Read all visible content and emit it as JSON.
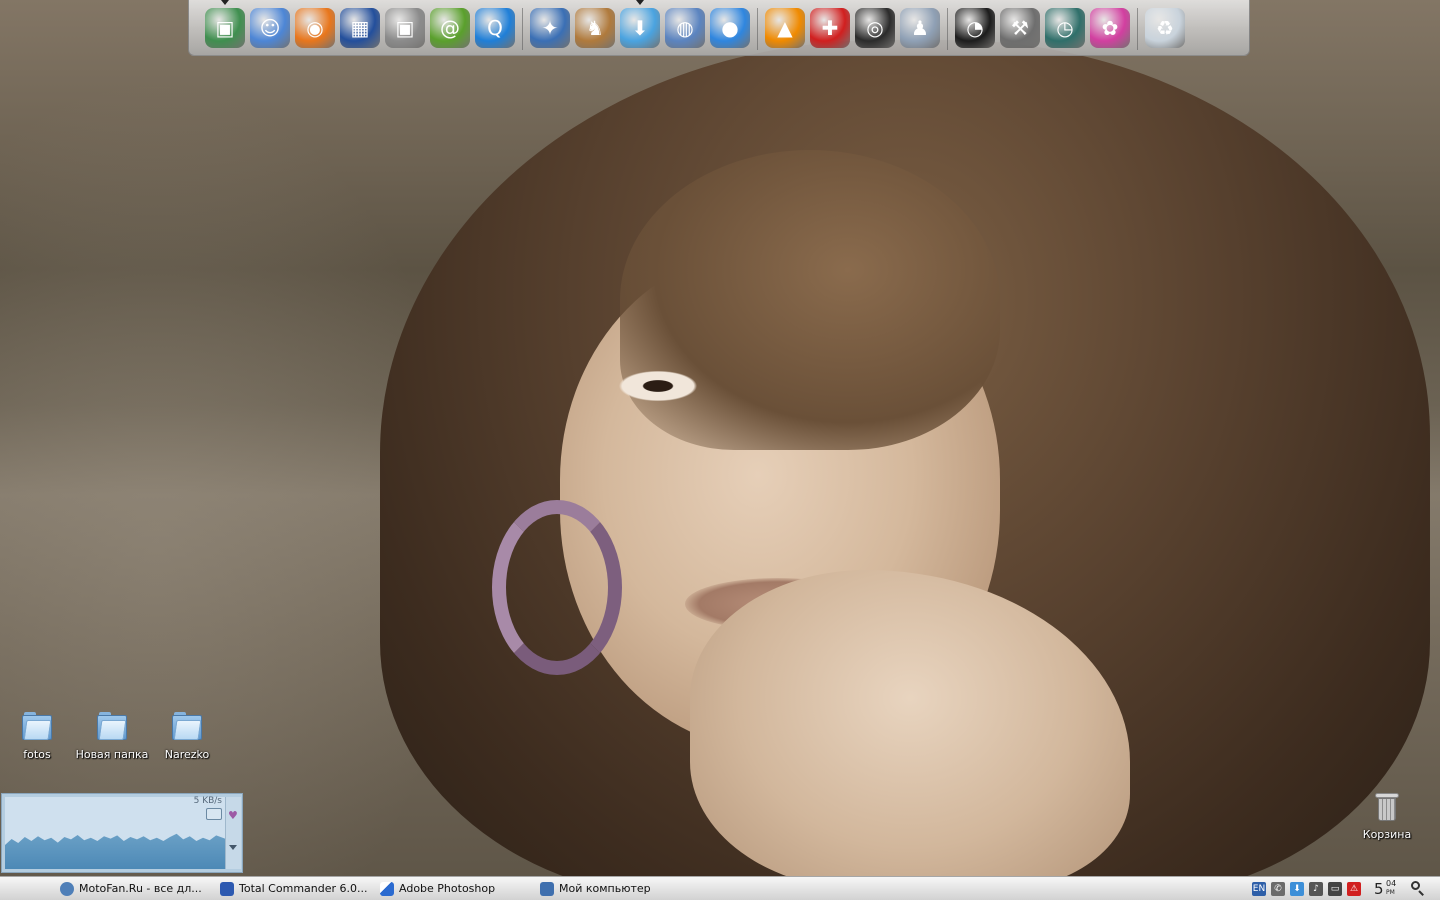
{
  "dock": {
    "groups": [
      [
        {
          "name": "desktop-manager-icon",
          "color": "#3f8f4f",
          "glyph": "▣"
        },
        {
          "name": "finder-icon",
          "color": "#4d86d6",
          "glyph": "☺"
        },
        {
          "name": "blender-icon",
          "color": "#e8761c",
          "glyph": "◉"
        },
        {
          "name": "mosaic-icon",
          "color": "#234f9c",
          "glyph": "▦"
        },
        {
          "name": "camera-icon",
          "color": "#8b8b8b",
          "glyph": "▣"
        },
        {
          "name": "swirl-icon",
          "color": "#5aa02c",
          "glyph": "@"
        },
        {
          "name": "quicktime-icon",
          "color": "#1f7fd8",
          "glyph": "Q"
        }
      ],
      [
        {
          "name": "safari-icon",
          "color": "#3a6fb5",
          "glyph": "✦"
        },
        {
          "name": "emule-icon",
          "color": "#b07a3c",
          "glyph": "♞"
        },
        {
          "name": "download-icon",
          "color": "#4aa3e0",
          "glyph": "⬇"
        },
        {
          "name": "network-globe-icon",
          "color": "#5b84c0",
          "glyph": "◍"
        },
        {
          "name": "video-chat-icon",
          "color": "#2f86df",
          "glyph": "●"
        }
      ],
      [
        {
          "name": "aimp-icon",
          "color": "#f08a00",
          "glyph": "▲"
        },
        {
          "name": "medic-plus-icon",
          "color": "#d11f1f",
          "glyph": "✚"
        },
        {
          "name": "dvd-disc-icon",
          "color": "#2b2b2b",
          "glyph": "◎"
        },
        {
          "name": "robot-icon",
          "color": "#8fa0b5",
          "glyph": "♟"
        }
      ],
      [
        {
          "name": "dashboard-icon",
          "color": "#1c1c1c",
          "glyph": "◔"
        },
        {
          "name": "hammer-icon",
          "color": "#6e6e6e",
          "glyph": "⚒"
        },
        {
          "name": "time-machine-icon",
          "color": "#2f6f6a",
          "glyph": "◷"
        },
        {
          "name": "cat-avatar-icon",
          "color": "#d23fa0",
          "glyph": "✿"
        }
      ],
      [
        {
          "name": "recycle-bin-icon",
          "color": "#c9d3dc",
          "glyph": "♻"
        }
      ]
    ]
  },
  "desktop": {
    "folders": [
      {
        "label": "fotos"
      },
      {
        "label": "Новая папка"
      },
      {
        "label": "Narezko"
      }
    ],
    "trash_label": "Корзина"
  },
  "meter": {
    "rate": "5 KB/s"
  },
  "taskbar": {
    "tasks": [
      {
        "label": "MotoFan.Ru - все дл...",
        "icon": "browser-icon",
        "color": "#4f7fb8"
      },
      {
        "label": "Total Commander 6.0...",
        "icon": "floppy-icon",
        "color": "#2d59b0"
      },
      {
        "label": "Adobe Photoshop",
        "icon": "feather-icon",
        "color": "#2a6ad0"
      },
      {
        "label": "Мой компьютер",
        "icon": "computer-icon",
        "color": "#3f6fae"
      }
    ],
    "tray": {
      "lang": "EN",
      "lang_color": "#2e5fa8"
    },
    "clock": {
      "hour": "5",
      "minute": "04",
      "ampm": "PM"
    }
  }
}
